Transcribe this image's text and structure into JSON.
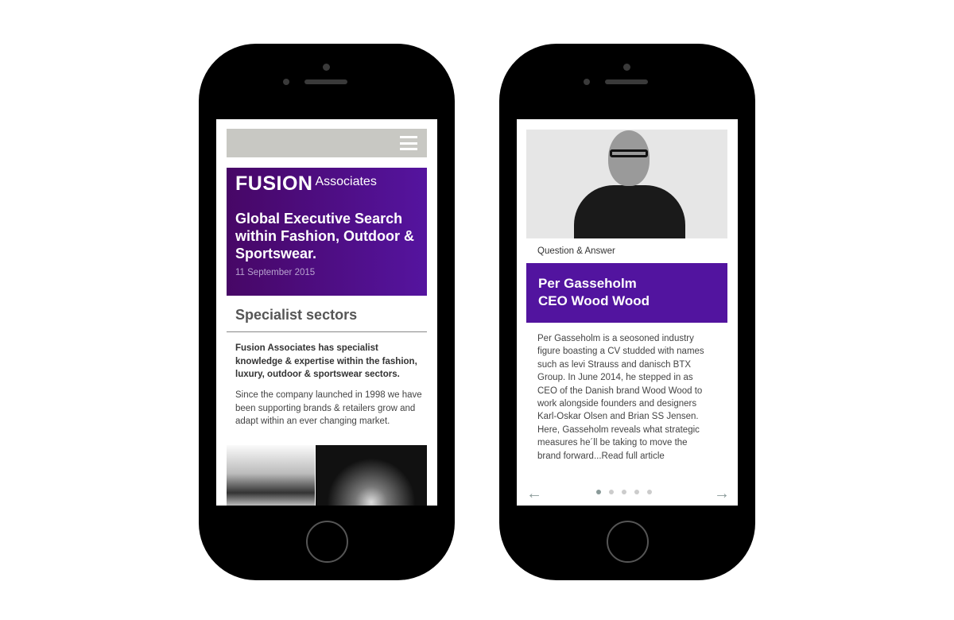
{
  "left_phone": {
    "menu_icon": "hamburger-icon",
    "brand_bold": "FUSION",
    "brand_light": "Associates",
    "headline": "Global Executive Search within Fashion, Outdoor & Sportswear.",
    "date": "11 September 2015",
    "section_title": "Specialist sectors",
    "lead": "Fusion Associates has specialist knowledge & expertise within the fashion, luxury, outdoor & sportswear sectors.",
    "body": "Since the company launched in 1998 we have been supporting brands & retailers grow and adapt within an ever changing market."
  },
  "right_phone": {
    "category": "Question & Answer",
    "title": "Per Gasseholm\nCEO Wood Wood",
    "article": "Per Gasseholm is a seosoned industry\nfigure boasting a CV studded with names\nsuch as levi Strauss and danisch BTX\nGroup. In June 2014, he stepped in as\nCEO of the Danish brand Wood Wood to\nwork alongside founders and designers\nKarl-Oskar Olsen and Brian SS Jensen.\nHere, Gasseholm reveals what strategic\nmeasures he´ll be taking to move the\nbrand forward...Read full article",
    "prev_arrow": "←",
    "next_arrow": "→",
    "carousel": {
      "total": 5,
      "active": 1
    },
    "accent": "#52149f"
  }
}
